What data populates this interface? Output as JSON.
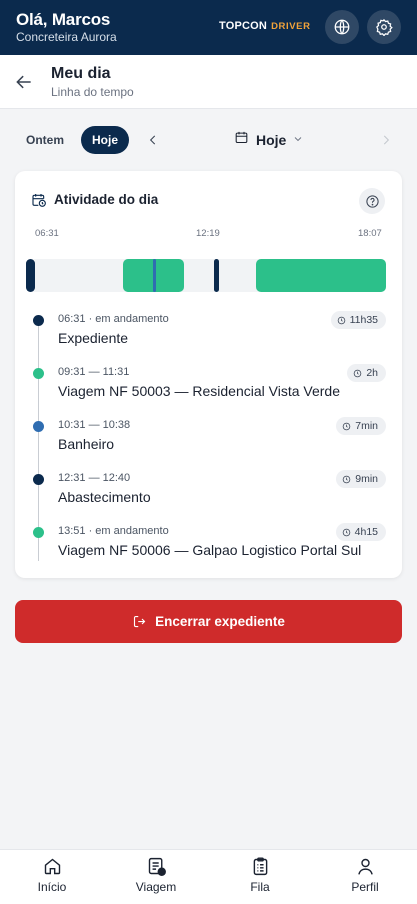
{
  "topbar": {
    "greeting": "Olá, Marcos",
    "company": "Concreteira Aurora",
    "brand_main": "TOPCON",
    "brand_sub": "DRIVER",
    "language_icon": "globe-icon",
    "settings_icon": "gear-icon"
  },
  "header": {
    "title": "Meu dia",
    "subtitle": "Linha do tempo",
    "back_icon": "arrow-left-icon"
  },
  "day_selector": {
    "yesterday_label": "Ontem",
    "today_label": "Hoje",
    "current_label": "Hoje",
    "selected": "Hoje"
  },
  "activity": {
    "title": "Atividade do dia",
    "timeline_ticks": [
      "06:31",
      "12:19",
      "18:07"
    ],
    "events": [
      {
        "meta": "06:31 · em andamento",
        "name": "Expediente",
        "duration": "11h35",
        "kind": "dark"
      },
      {
        "meta": "09:31 — 11:31",
        "name": "Viagem NF 50003 — Residencial Vista Verde",
        "duration": "2h",
        "kind": "green"
      },
      {
        "meta": "10:31 — 10:38",
        "name": "Banheiro",
        "duration": "7min",
        "kind": "blue"
      },
      {
        "meta": "12:31 — 12:40",
        "name": "Abastecimento",
        "duration": "9min",
        "kind": "dark"
      },
      {
        "meta": "13:51 · em andamento",
        "name": "Viagem NF 50006 — Galpao Logistico Portal Sul",
        "duration": "4h15",
        "kind": "green"
      }
    ]
  },
  "end_button": {
    "label": "Encerrar expediente"
  },
  "nav": {
    "items": [
      {
        "label": "Início",
        "icon": "home-icon"
      },
      {
        "label": "Viagem",
        "icon": "trip-icon"
      },
      {
        "label": "Fila",
        "icon": "queue-icon"
      },
      {
        "label": "Perfil",
        "icon": "profile-icon"
      }
    ]
  },
  "colors": {
    "primary": "#0b2a4d",
    "accent_orange": "#f2a33a",
    "trip_green": "#2cc08a",
    "break_blue": "#2f6db1",
    "danger": "#cf2b2b"
  }
}
